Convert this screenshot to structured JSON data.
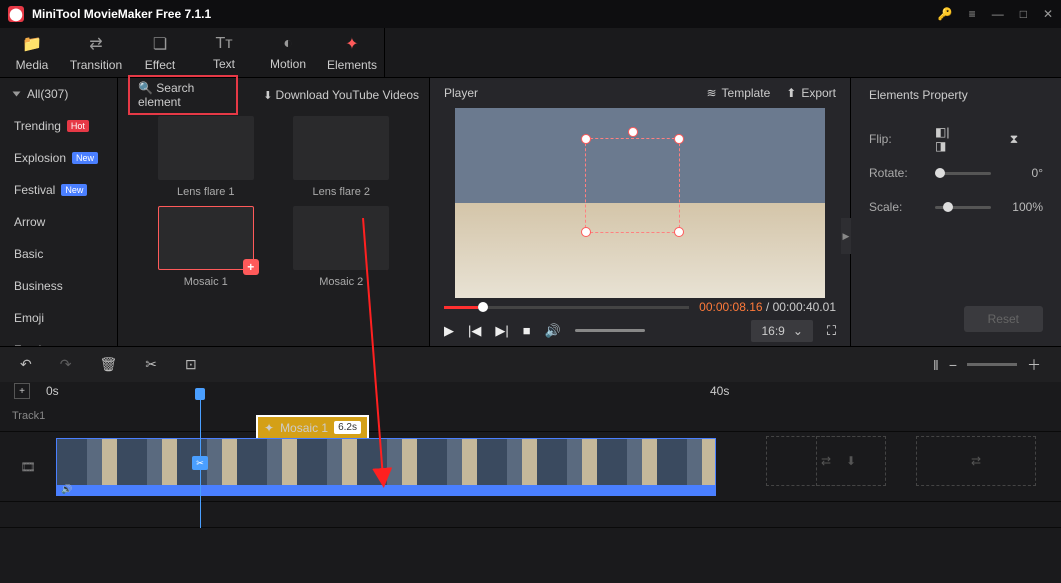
{
  "app": {
    "title": "MiniTool MovieMaker Free 7.1.1"
  },
  "tabs": {
    "media": "Media",
    "transition": "Transition",
    "effect": "Effect",
    "text": "Text",
    "motion": "Motion",
    "elements": "Elements"
  },
  "sidebar": {
    "all": "All(307)",
    "items": [
      {
        "label": "Trending",
        "badge": "Hot",
        "badgeCls": "hot"
      },
      {
        "label": "Explosion",
        "badge": "New",
        "badgeCls": "new"
      },
      {
        "label": "Festival",
        "badge": "New",
        "badgeCls": "new"
      },
      {
        "label": "Arrow"
      },
      {
        "label": "Basic",
        "sel": true
      },
      {
        "label": "Business"
      },
      {
        "label": "Emoji"
      },
      {
        "label": "Food"
      }
    ]
  },
  "search": {
    "placeholder": "Search element"
  },
  "download": "Download YouTube Videos",
  "library": {
    "items": [
      {
        "name": "Lens flare 1"
      },
      {
        "name": "Lens flare 2"
      },
      {
        "name": "Mosaic 1",
        "sel": true,
        "add": true
      },
      {
        "name": "Mosaic 2"
      }
    ]
  },
  "player": {
    "title": "Player",
    "template": "Template",
    "export": "Export",
    "cur": "00:00:08.16",
    "total": "00:00:40.01",
    "sep": " / ",
    "aspect": "16:9"
  },
  "props": {
    "title": "Elements Property",
    "flip": "Flip:",
    "rotate": "Rotate:",
    "rotateVal": "0°",
    "scale": "Scale:",
    "scaleVal": "100%",
    "reset": "Reset"
  },
  "timeline": {
    "t0": "0s",
    "t40": "40s",
    "track1": "Track1",
    "clip": {
      "name": "Mosaic 1",
      "dur": "6.2s"
    }
  }
}
